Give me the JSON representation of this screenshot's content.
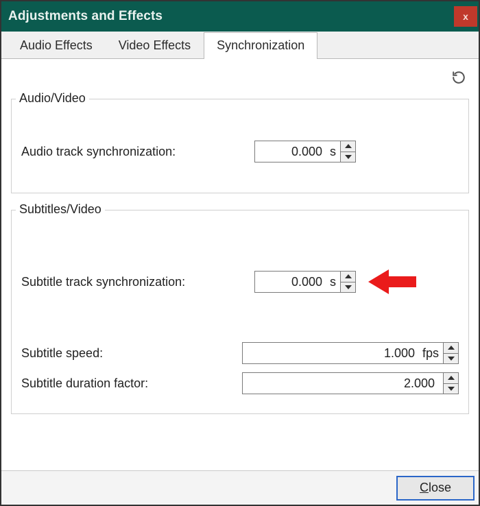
{
  "window": {
    "title": "Adjustments and Effects",
    "close_symbol": "x"
  },
  "tabs": {
    "audio_effects": "Audio Effects",
    "video_effects": "Video Effects",
    "synchronization": "Synchronization"
  },
  "sync": {
    "group_av_title": "Audio/Video",
    "audio_sync_label": "Audio track synchronization:",
    "audio_sync_value": "0.000",
    "audio_sync_unit": " s",
    "group_sub_title": "Subtitles/Video",
    "subtitle_sync_label": "Subtitle track synchronization:",
    "subtitle_sync_value": "0.000",
    "subtitle_sync_unit": " s",
    "subtitle_speed_label": "Subtitle speed:",
    "subtitle_speed_value": "1.000",
    "subtitle_speed_unit": " fps",
    "subtitle_dur_label": "Subtitle duration factor:",
    "subtitle_dur_value": "2.000",
    "subtitle_dur_unit": ""
  },
  "footer": {
    "close_underline": "C",
    "close_rest": "lose"
  },
  "icons": {
    "refresh": "refresh-icon"
  }
}
